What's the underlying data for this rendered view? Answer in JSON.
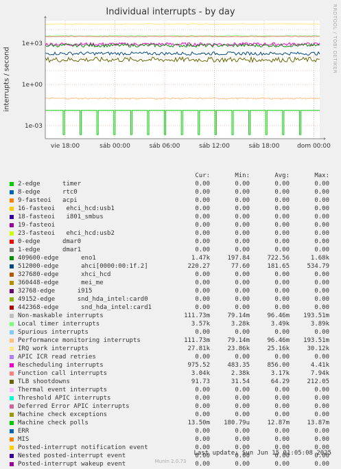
{
  "chart_data": {
    "type": "line",
    "title": "Individual interrupts - by day",
    "ylabel": "interrupts / second",
    "yscale": "log",
    "yticks": [
      "1e+03",
      "1e+00",
      "1e-03"
    ],
    "xticks": [
      "vie 18:00",
      "sáb 00:00",
      "sáb 06:00",
      "sáb 12:00",
      "sáb 18:00",
      "dom 00:00"
    ],
    "columns": [
      "Cur:",
      "Min:",
      "Avg:",
      "Max:"
    ],
    "series": [
      {
        "name": "2-edge      timer",
        "color": "#00cc00",
        "cur": "0.00",
        "min": "0.00",
        "avg": "0.00",
        "max": "0.00"
      },
      {
        "name": "8-edge      rtc0",
        "color": "#0066b3",
        "cur": "0.00",
        "min": "0.00",
        "avg": "0.00",
        "max": "0.00"
      },
      {
        "name": "9-fasteoi   acpi",
        "color": "#ff8000",
        "cur": "0.00",
        "min": "0.00",
        "avg": "0.00",
        "max": "0.00"
      },
      {
        "name": "16-fasteoi   ehci_hcd:usb1",
        "color": "#ffcc00",
        "cur": "0.00",
        "min": "0.00",
        "avg": "0.00",
        "max": "0.00"
      },
      {
        "name": "18-fasteoi   i801_smbus",
        "color": "#330099",
        "cur": "0.00",
        "min": "0.00",
        "avg": "0.00",
        "max": "0.00"
      },
      {
        "name": "19-fasteoi",
        "color": "#990099",
        "cur": "0.00",
        "min": "0.00",
        "avg": "0.00",
        "max": "0.00"
      },
      {
        "name": "23-fasteoi   ehci_hcd:usb2",
        "color": "#ccff00",
        "cur": "0.00",
        "min": "0.00",
        "avg": "0.00",
        "max": "0.00"
      },
      {
        "name": "0-edge      dmar0",
        "color": "#ff0000",
        "cur": "0.00",
        "min": "0.00",
        "avg": "0.00",
        "max": "0.00"
      },
      {
        "name": "1-edge      dmar1",
        "color": "#808080",
        "cur": "0.00",
        "min": "0.00",
        "avg": "0.00",
        "max": "0.00"
      },
      {
        "name": "409600-edge      eno1",
        "color": "#008f00",
        "cur": "1.47k",
        "min": "197.84",
        "avg": "722.56",
        "max": "1.68k"
      },
      {
        "name": "512000-edge      ahci[0000:00:1f.2]",
        "color": "#00487d",
        "cur": "220.27",
        "min": "77.60",
        "avg": "181.65",
        "max": "534.79"
      },
      {
        "name": "327680-edge      xhci_hcd",
        "color": "#b35a00",
        "cur": "0.00",
        "min": "0.00",
        "avg": "0.00",
        "max": "0.00"
      },
      {
        "name": "360448-edge      mei_me",
        "color": "#b38f00",
        "cur": "0.00",
        "min": "0.00",
        "avg": "0.00",
        "max": "0.00"
      },
      {
        "name": "32768-edge      i915",
        "color": "#6b006b",
        "cur": "0.00",
        "min": "0.00",
        "avg": "0.00",
        "max": "0.00"
      },
      {
        "name": "49152-edge      snd_hda_intel:card0",
        "color": "#8fb300",
        "cur": "0.00",
        "min": "0.00",
        "avg": "0.00",
        "max": "0.00"
      },
      {
        "name": "442368-edge      snd_hda_intel:card1",
        "color": "#b30000",
        "cur": "0.00",
        "min": "0.00",
        "avg": "0.00",
        "max": "0.00"
      },
      {
        "name": "Non-maskable interrupts",
        "color": "#bebebe",
        "cur": "111.73m",
        "min": "79.14m",
        "avg": "96.46m",
        "max": "193.51m"
      },
      {
        "name": "Local timer interrupts",
        "color": "#80ff80",
        "cur": "3.57k",
        "min": "3.28k",
        "avg": "3.49k",
        "max": "3.89k"
      },
      {
        "name": "Spurious interrupts",
        "color": "#80c9ff",
        "cur": "0.00",
        "min": "0.00",
        "avg": "0.00",
        "max": "0.00"
      },
      {
        "name": "Performance monitoring interrupts",
        "color": "#ffc080",
        "cur": "111.73m",
        "min": "79.14m",
        "avg": "96.46m",
        "max": "193.51m"
      },
      {
        "name": "IRQ work interrupts",
        "color": "#ffe680",
        "cur": "27.81k",
        "min": "23.86k",
        "avg": "25.16k",
        "max": "30.12k"
      },
      {
        "name": "APIC ICR read retries",
        "color": "#aa80ff",
        "cur": "0.00",
        "min": "0.00",
        "avg": "0.00",
        "max": "0.00"
      },
      {
        "name": "Rescheduling interrupts",
        "color": "#ee00cc",
        "cur": "975.52",
        "min": "483.35",
        "avg": "856.00",
        "max": "4.41k"
      },
      {
        "name": "Function call interrupts",
        "color": "#ff8080",
        "cur": "3.04k",
        "min": "2.38k",
        "avg": "3.17k",
        "max": "7.94k"
      },
      {
        "name": "TLB shootdowns",
        "color": "#666600",
        "cur": "91.73",
        "min": "31.54",
        "avg": "64.29",
        "max": "212.05"
      },
      {
        "name": "Thermal event interrupts",
        "color": "#ffbfff",
        "cur": "0.00",
        "min": "0.00",
        "avg": "0.00",
        "max": "0.00"
      },
      {
        "name": "Threshold APIC interrupts",
        "color": "#00ffcc",
        "cur": "0.00",
        "min": "0.00",
        "avg": "0.00",
        "max": "0.00"
      },
      {
        "name": "Deferred Error APIC interrupts",
        "color": "#cc6699",
        "cur": "0.00",
        "min": "0.00",
        "avg": "0.00",
        "max": "0.00"
      },
      {
        "name": "Machine check exceptions",
        "color": "#999900",
        "cur": "0.00",
        "min": "0.00",
        "avg": "0.00",
        "max": "0.00"
      },
      {
        "name": "Machine check polls",
        "color": "#00cc00",
        "cur": "13.50m",
        "min": "180.79u",
        "avg": "12.87m",
        "max": "13.87m"
      },
      {
        "name": "ERR",
        "color": "#0066b3",
        "cur": "0.00",
        "min": "0.00",
        "avg": "0.00",
        "max": "0.00"
      },
      {
        "name": "MIS",
        "color": "#ff8000",
        "cur": "0.00",
        "min": "0.00",
        "avg": "0.00",
        "max": "0.00"
      },
      {
        "name": "Posted-interrupt notification event",
        "color": "#ffcc00",
        "cur": "0.00",
        "min": "0.00",
        "avg": "0.00",
        "max": "0.00"
      },
      {
        "name": "Nested posted-interrupt event",
        "color": "#330099",
        "cur": "0.00",
        "min": "0.00",
        "avg": "0.00",
        "max": "0.00"
      },
      {
        "name": "Posted-interrupt wakeup event",
        "color": "#990099",
        "cur": "0.00",
        "min": "0.00",
        "avg": "0.00",
        "max": "0.00"
      }
    ],
    "plotted_lines": [
      {
        "series": "IRQ work interrupts",
        "level": 25000,
        "color": "#ffe680"
      },
      {
        "series": "Local timer interrupts",
        "level": 3500,
        "color": "#80ff80"
      },
      {
        "series": "Function call interrupts",
        "level": 3100,
        "color": "#ff8080"
      },
      {
        "series": "Rescheduling interrupts",
        "level": 850,
        "color": "#ee00cc"
      },
      {
        "series": "409600-edge eno1",
        "level": 700,
        "color": "#008f00"
      },
      {
        "series": "512000-edge ahci",
        "level": 180,
        "color": "#00487d"
      },
      {
        "series": "TLB shootdowns",
        "level": 64,
        "color": "#666600"
      },
      {
        "series": "Performance monitoring interrupts",
        "level": 0.096,
        "color": "#ffc080"
      },
      {
        "series": "Machine check polls",
        "level": 0.0129,
        "color": "#00cc00"
      }
    ]
  },
  "footer": {
    "last_update": "Last update: Sun Jun 15 01:05:08 2025",
    "munin": "Munin 2.0.73",
    "side_label": "RRDTOOL / TOBI OETIKER"
  }
}
